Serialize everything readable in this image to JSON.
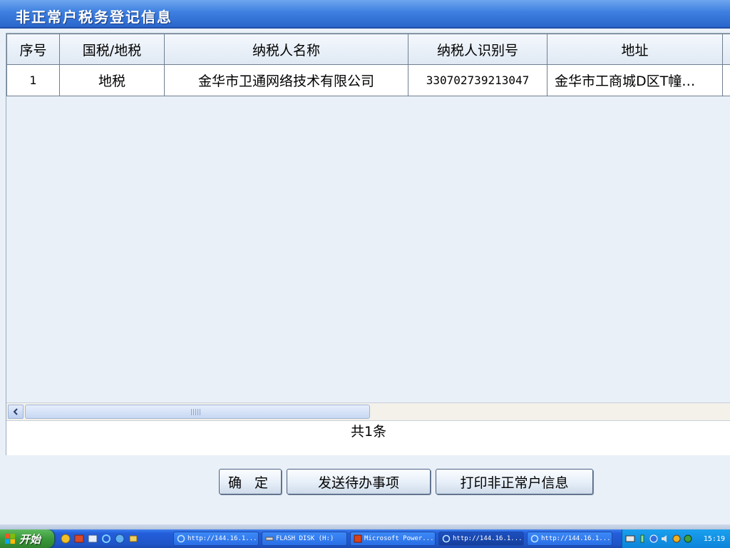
{
  "window": {
    "title": "非正常户税务登记信息"
  },
  "table": {
    "columns": [
      "序号",
      "国税/地税",
      "纳税人名称",
      "纳税人识别号",
      "地址"
    ],
    "rows": [
      {
        "index": "1",
        "tax_type": "地税",
        "taxpayer_name": "金华市卫通网络技术有限公司",
        "taxpayer_id": "330702739213047",
        "address": "金华市工商城D区T幢…"
      }
    ]
  },
  "pager": {
    "count_text": "共1条"
  },
  "buttons": {
    "confirm": "确 定",
    "send_todo": "发送待办事项",
    "print": "打印非正常户信息"
  },
  "taskbar": {
    "start_label": "开始",
    "tasks": [
      {
        "label": "http://144.16.1...",
        "icon": "ie-icon"
      },
      {
        "label": "FLASH DISK (H:)",
        "icon": "drive-icon"
      },
      {
        "label": "Microsoft Power...",
        "icon": "powerpoint-icon"
      },
      {
        "label": "http://144.16.1...",
        "icon": "ie-icon"
      },
      {
        "label": "http://144.16.1...",
        "icon": "ie-icon"
      }
    ],
    "clock": "15:19"
  },
  "colors": {
    "title_bar": "#3d7fe0",
    "grid_border": "#6f7f90",
    "taskbar": "#245edb",
    "start_button": "#3a9a3a",
    "tray": "#0d84d9"
  }
}
